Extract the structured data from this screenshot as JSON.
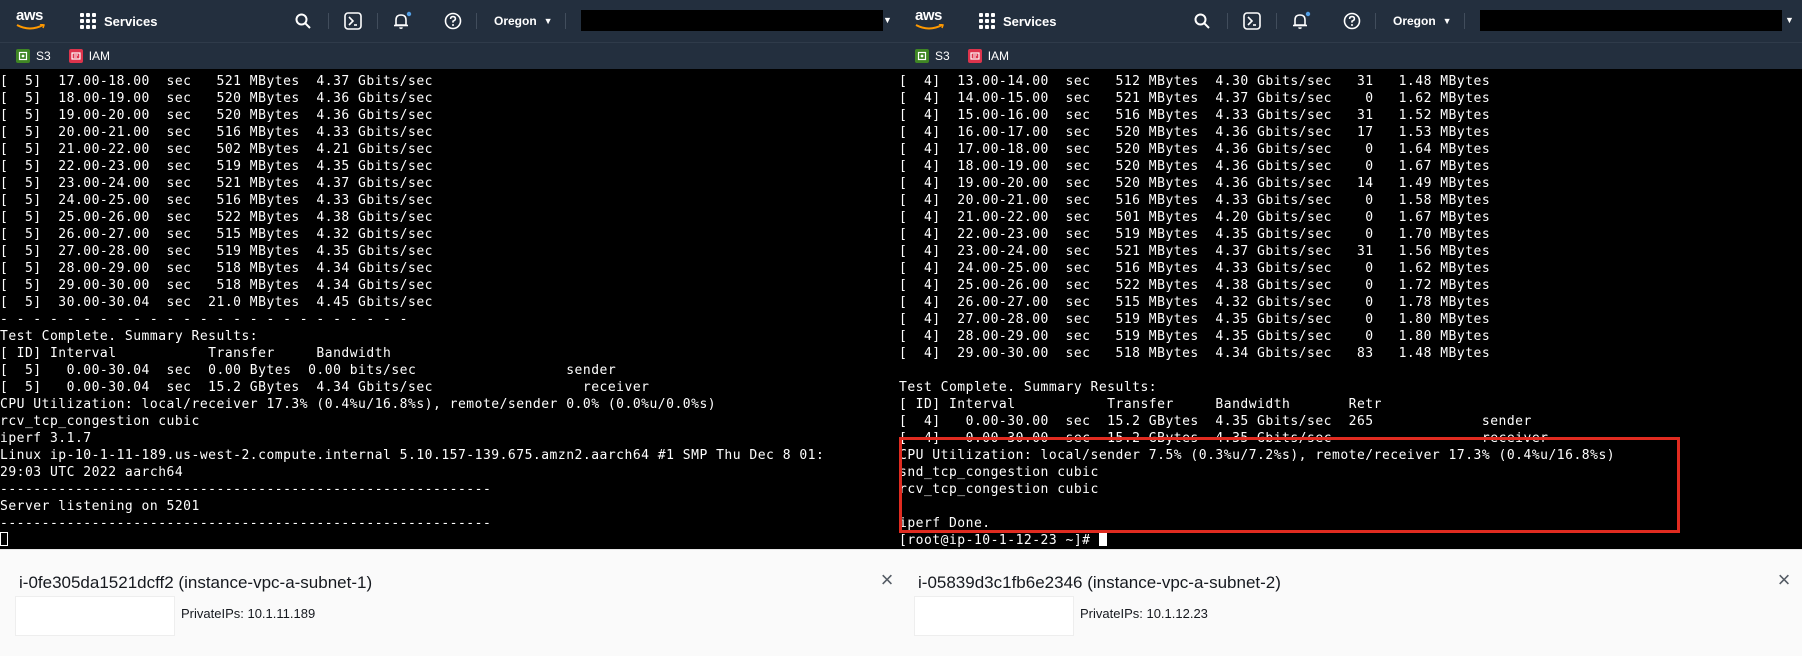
{
  "nav": {
    "logo_text": "aws",
    "services_label": "Services",
    "region_label": "Oregon",
    "icons": [
      "search-icon",
      "cloudshell-icon",
      "notifications-icon",
      "help-icon",
      "caret-down-icon"
    ]
  },
  "favorites": [
    {
      "label": "S3",
      "icon": "s3-icon",
      "color": "#3f8624"
    },
    {
      "label": "IAM",
      "icon": "iam-icon",
      "color": "#dd344c"
    }
  ],
  "colors": {
    "nav_bg": "#232f3e",
    "terminal_bg": "#000000",
    "terminal_fg": "#ffffff",
    "highlight": "#e02b20"
  },
  "left": {
    "terminal_lines": [
      "[  5]  17.00-18.00  sec   521 MBytes  4.37 Gbits/sec",
      "[  5]  18.00-19.00  sec   520 MBytes  4.36 Gbits/sec",
      "[  5]  19.00-20.00  sec   520 MBytes  4.36 Gbits/sec",
      "[  5]  20.00-21.00  sec   516 MBytes  4.33 Gbits/sec",
      "[  5]  21.00-22.00  sec   502 MBytes  4.21 Gbits/sec",
      "[  5]  22.00-23.00  sec   519 MBytes  4.35 Gbits/sec",
      "[  5]  23.00-24.00  sec   521 MBytes  4.37 Gbits/sec",
      "[  5]  24.00-25.00  sec   516 MBytes  4.33 Gbits/sec",
      "[  5]  25.00-26.00  sec   522 MBytes  4.38 Gbits/sec",
      "[  5]  26.00-27.00  sec   515 MBytes  4.32 Gbits/sec",
      "[  5]  27.00-28.00  sec   519 MBytes  4.35 Gbits/sec",
      "[  5]  28.00-29.00  sec   518 MBytes  4.34 Gbits/sec",
      "[  5]  29.00-30.00  sec   518 MBytes  4.34 Gbits/sec",
      "[  5]  30.00-30.04  sec  21.0 MBytes  4.45 Gbits/sec",
      "- - - - - - - - - - - - - - - - - - - - - - - - -",
      "Test Complete. Summary Results:",
      "[ ID] Interval           Transfer     Bandwidth",
      "[  5]   0.00-30.04  sec  0.00 Bytes  0.00 bits/sec                  sender",
      "[  5]   0.00-30.04  sec  15.2 GBytes  4.34 Gbits/sec                  receiver",
      "CPU Utilization: local/receiver 17.3% (0.4%u/16.8%s), remote/sender 0.0% (0.0%u/0.0%s)",
      "rcv_tcp_congestion cubic",
      "iperf 3.1.7",
      "Linux ip-10-1-11-189.us-west-2.compute.internal 5.10.157-139.675.amzn2.aarch64 #1 SMP Thu Dec 8 01:",
      "29:03 UTC 2022 aarch64",
      "-----------------------------------------------------------",
      "Server listening on 5201",
      "-----------------------------------------------------------"
    ],
    "instance_title": "i-0fe305da1521dcff2 (instance-vpc-a-subnet-1)",
    "private_ips": "PrivateIPs: 10.1.11.189"
  },
  "right": {
    "terminal_lines": [
      "[  4]  13.00-14.00  sec   512 MBytes  4.30 Gbits/sec   31   1.48 MBytes",
      "[  4]  14.00-15.00  sec   521 MBytes  4.37 Gbits/sec    0   1.62 MBytes",
      "[  4]  15.00-16.00  sec   516 MBytes  4.33 Gbits/sec   31   1.52 MBytes",
      "[  4]  16.00-17.00  sec   520 MBytes  4.36 Gbits/sec   17   1.53 MBytes",
      "[  4]  17.00-18.00  sec   520 MBytes  4.36 Gbits/sec    0   1.64 MBytes",
      "[  4]  18.00-19.00  sec   520 MBytes  4.36 Gbits/sec    0   1.67 MBytes",
      "[  4]  19.00-20.00  sec   520 MBytes  4.36 Gbits/sec   14   1.49 MBytes",
      "[  4]  20.00-21.00  sec   516 MBytes  4.33 Gbits/sec    0   1.58 MBytes",
      "[  4]  21.00-22.00  sec   501 MBytes  4.20 Gbits/sec    0   1.67 MBytes",
      "[  4]  22.00-23.00  sec   519 MBytes  4.35 Gbits/sec    0   1.70 MBytes",
      "[  4]  23.00-24.00  sec   521 MBytes  4.37 Gbits/sec   31   1.56 MBytes",
      "[  4]  24.00-25.00  sec   516 MBytes  4.33 Gbits/sec    0   1.62 MBytes",
      "[  4]  25.00-26.00  sec   522 MBytes  4.38 Gbits/sec    0   1.72 MBytes",
      "[  4]  26.00-27.00  sec   515 MBytes  4.32 Gbits/sec    0   1.78 MBytes",
      "[  4]  27.00-28.00  sec   519 MBytes  4.35 Gbits/sec    0   1.80 MBytes",
      "[  4]  28.00-29.00  sec   519 MBytes  4.35 Gbits/sec    0   1.80 MBytes",
      "[  4]  29.00-30.00  sec   518 MBytes  4.34 Gbits/sec   83   1.48 MBytes",
      "",
      "Test Complete. Summary Results:",
      "[ ID] Interval           Transfer     Bandwidth       Retr",
      "[  4]   0.00-30.00  sec  15.2 GBytes  4.35 Gbits/sec  265             sender",
      "[  4]   0.00-30.00  sec  15.2 GBytes  4.35 Gbits/sec                  receiver",
      "CPU Utilization: local/sender 7.5% (0.3%u/7.2%s), remote/receiver 17.3% (0.4%u/16.8%s)",
      "snd_tcp_congestion cubic",
      "rcv_tcp_congestion cubic",
      "",
      "iperf Done."
    ],
    "prompt": "[root@ip-10-1-12-23 ~]# ",
    "instance_title": "i-05839d3c1fb6e2346 (instance-vpc-a-subnet-2)",
    "private_ips": "PrivateIPs: 10.1.12.23"
  }
}
